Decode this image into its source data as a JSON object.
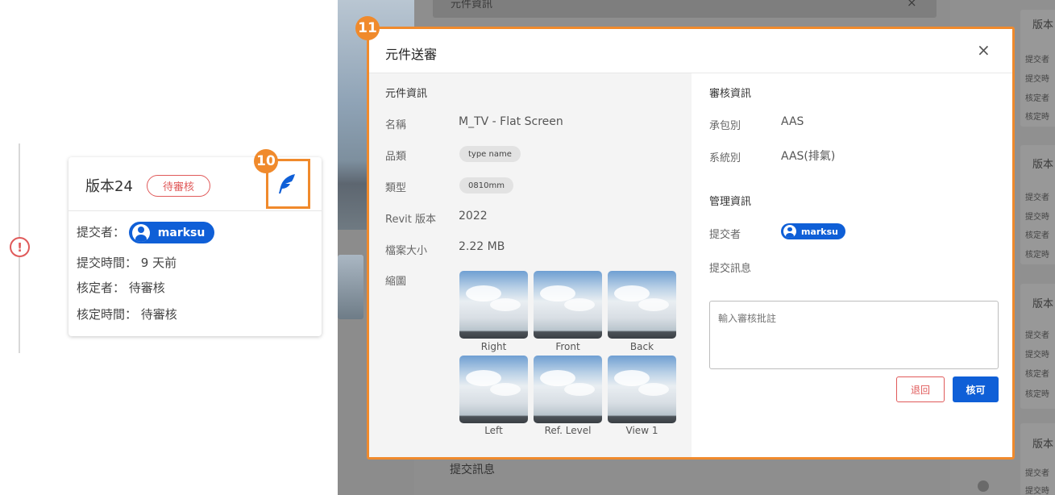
{
  "version_card": {
    "title": "版本24",
    "status_badge": "待審核",
    "submitter_label": "提交者：",
    "submitter_name": "marksu",
    "submit_time": "提交時間： 9 天前",
    "approver": "核定者： 待審核",
    "approve_time": "核定時間： 待審核",
    "callout_number": "10"
  },
  "background": {
    "top_text": "元件資訊",
    "bottom_text": "提交訊息",
    "side_versions": [
      {
        "title": "版本",
        "lines": [
          "提交者",
          "提交時",
          "核定者",
          "核定時"
        ]
      },
      {
        "title": "版本",
        "lines": [
          "提交者",
          "提交時",
          "核定者",
          "核定時"
        ]
      },
      {
        "title": "版本",
        "lines": [
          "提交者",
          "提交時",
          "核定者",
          "核定時"
        ]
      },
      {
        "title": "版本",
        "lines": [
          "提交者",
          "提交時"
        ]
      }
    ]
  },
  "modal": {
    "callout_number": "11",
    "title": "元件送審",
    "close": "×",
    "component_info": {
      "heading": "元件資訊",
      "name_label": "名稱",
      "name_value": "M_TV - Flat Screen",
      "family_label": "品類",
      "family_value": "type name",
      "type_label": "類型",
      "type_value": "0810mm",
      "revit_label": "Revit 版本",
      "revit_value": "2022",
      "size_label": "檔案大小",
      "size_value": "2.22 MB",
      "thumb_label": "縮圖",
      "thumbnails": [
        "Right",
        "Front",
        "Back",
        "Left",
        "Ref. Level",
        "View 1"
      ]
    },
    "review_info": {
      "heading": "審核資訊",
      "contractor_label": "承包別",
      "contractor_value": "AAS",
      "system_label": "系統別",
      "system_value": "AAS(排氣)"
    },
    "management_info": {
      "heading": "管理資訊",
      "submitter_label": "提交者",
      "submitter_name": "marksu",
      "message_label": "提交訊息",
      "comment_placeholder": "輸入審核批註",
      "return_button": "退回",
      "approve_button": "核可"
    }
  },
  "colors": {
    "accent_orange": "#f08a2c",
    "primary_blue": "#0f5fd7",
    "danger_red": "#e05a5a"
  }
}
